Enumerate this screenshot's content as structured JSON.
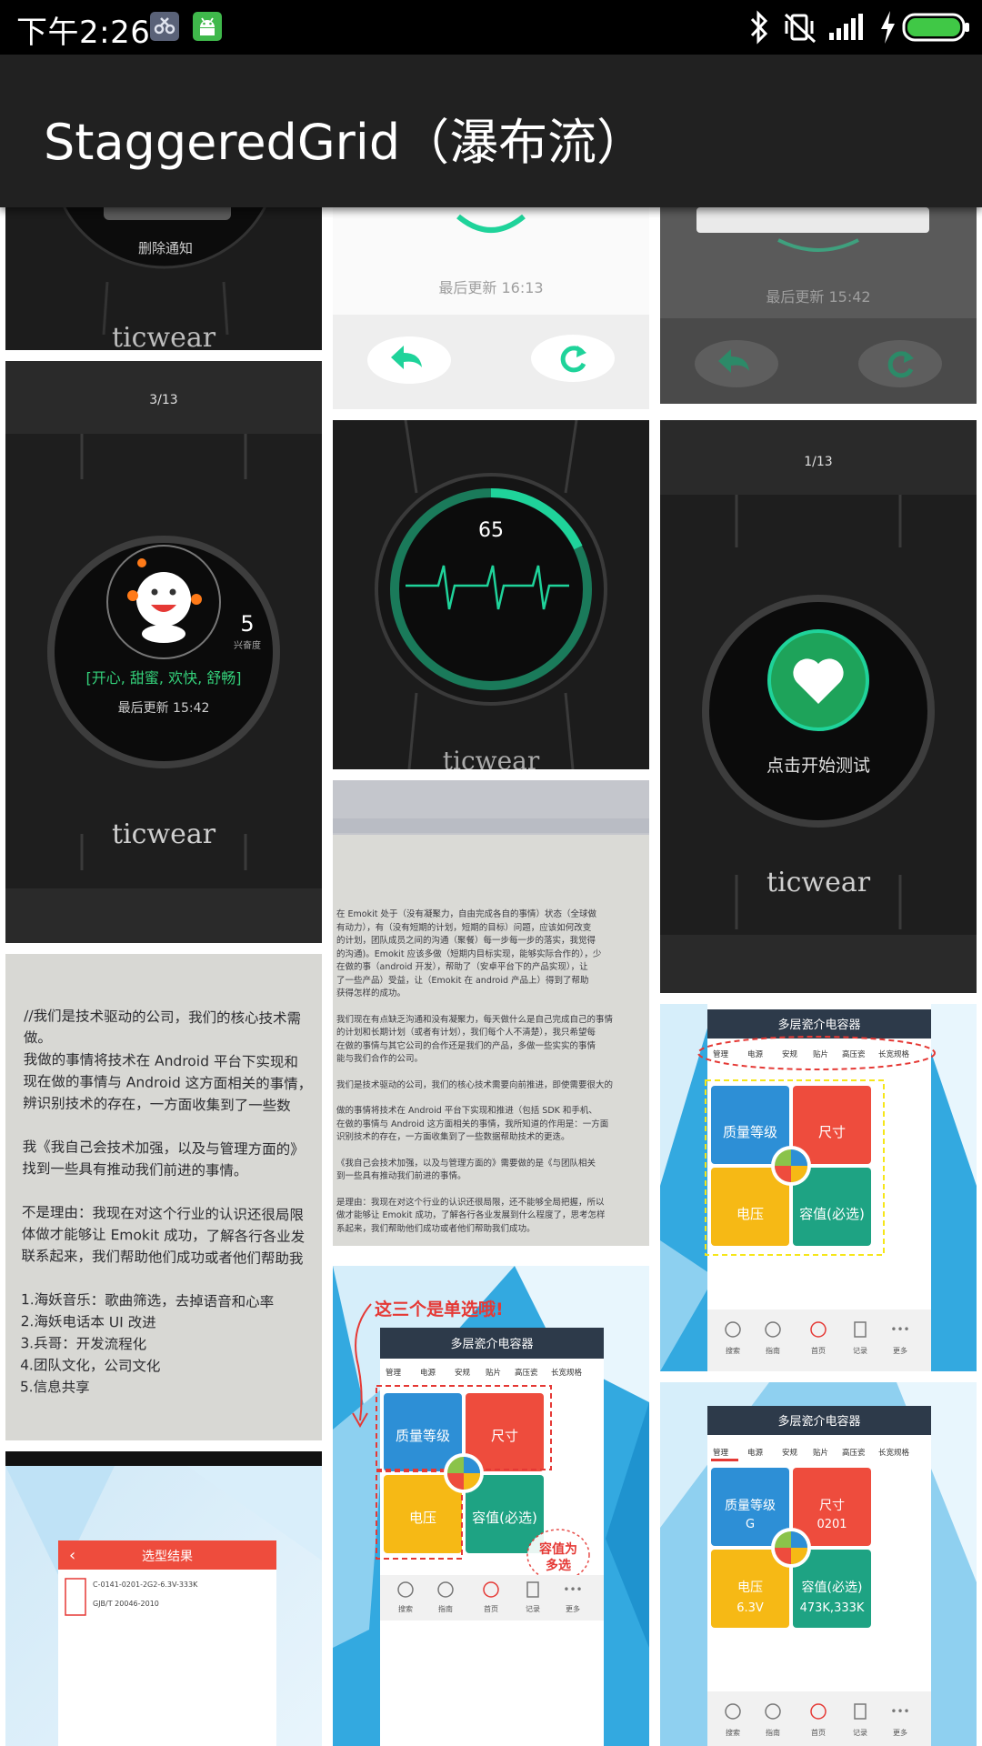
{
  "status_bar": {
    "time": "下午2:26",
    "icons": [
      "debug-app-icon",
      "android-icon",
      "bluetooth-icon",
      "vibrate-off-icon",
      "signal-icon",
      "charging-icon",
      "battery-icon"
    ]
  },
  "app_bar": {
    "title": "StaggeredGrid（瀑布流）"
  },
  "tiles": {
    "t1": {
      "brand": "ticwear",
      "menu": "删除通知"
    },
    "t2": {
      "updated": "最后更新 16:13"
    },
    "t3": {
      "updated": "最后更新 15:42"
    },
    "t4": {
      "count": "5",
      "count_label": "兴奋度",
      "moods": "[开心, 甜蜜, 欢快, 舒畅]",
      "updated": "最后更新 15:42",
      "brand": "ticwear",
      "header": "3/13"
    },
    "t5": {
      "heart_rate": "65",
      "brand": "ticwear"
    },
    "t6": {
      "prompt": "点击开始测试",
      "brand": "ticwear",
      "header": "1/13"
    },
    "t7": {
      "lines": [
        "//我们是技术驱动的公司，我们的核心技术需",
        "做。",
        "我做的事情将技术在 Android 平台下实现和",
        "现在做的事情与 Android 这方面相关的事情，",
        "辨识别技术的存在，一方面收集到了一些数",
        "",
        "我《我自己会技术加强，以及与管理方面的》",
        "找到一些具有推动我们前进的事情。",
        "",
        "不是理由：我现在对这个行业的认识还很局限",
        "体做才能够让 Emokit 成功，了解各行各业发",
        "联系起来，我们帮助他们成功或者他们帮助我",
        "",
        "1.海妖音乐：歌曲筛选，去掉语音和心率",
        "2.海妖电话本 UI 改进",
        "3.兵哥：开发流程化",
        "4.团队文化，公司文化",
        "5.信息共享"
      ]
    },
    "t8": {
      "lines": [
        "在 Emokit 处于（没有凝聚力，自由完成各自的事情）状态（全球做",
        "有动力），有（没有短期的计划，短期的目标）问题，应该如何改变",
        "的计划，团队成员之间的沟通（聚餐）每一步每一步的落实，我觉得",
        "的沟通)。Emokit 应该多做（短期内目标实现，能够实际合作的），少",
        "在做的事（android 开发），帮助了（安卓平台下的产品实现），让",
        "了一些产品）受益，让（Emokit 在 android 产品上）得到了帮助",
        "获得怎样的成功。",
        "",
        "我们现在有点缺乏沟通和没有凝聚力，每天做什么是自己完成自己的事情",
        "的计划和长期计划（或者有计划），我们每个人不清楚），我只希望每",
        "在做的事情与其它公司的合作还是我们的产品，多做一些实实的事情",
        "能与我们合作的公司。",
        "",
        "我们是技术驱动的公司，我们的核心技术需要向前推进，即使需要很大的",
        "",
        "做的事情将技术在 Android 平台下实现和推进（包括 SDK 和手机、",
        "在做的事情与 Android 这方面相关的事情，我所知道的作用是：一方面",
        "识别技术的存在，一方面收集到了一些数据帮助技术的更迭。",
        "",
        "《我自己会技术加强，以及与管理方面的》需要做的是《与团队相关",
        "到一些具有推动我们前进的事情。",
        "",
        "是理由：我现在对这个行业的认识还很局限，还不能够全局把握，所以",
        "做才能够让 Emokit 成功，了解各行各业发展到什么程度了，思考怎样",
        "系起来，我们帮助他们成功或者他们帮助我们成功。"
      ]
    },
    "t9": {
      "header": "多层瓷介电容器",
      "tabs": [
        "管理",
        "电源",
        "安规",
        "贴片",
        "高压瓷",
        "长宽规格"
      ],
      "cells": [
        "质量等级",
        "尺寸",
        "电压",
        "容值(必选)"
      ],
      "nav": [
        "搜索",
        "指南",
        "首页",
        "记录",
        "更多"
      ]
    },
    "t10": {
      "annotation_top": "这三个是单选哦!",
      "header": "多层瓷介电容器",
      "tabs": [
        "管理",
        "电源",
        "安规",
        "贴片",
        "高压瓷",
        "长宽规格"
      ],
      "cells": [
        "质量等级",
        "尺寸",
        "电压",
        "容值(必选)"
      ],
      "annotation_bottom": "容值为\n多选",
      "nav": [
        "搜索",
        "指南",
        "首页",
        "记录",
        "更多"
      ]
    },
    "t11": {
      "header": "多层瓷介电容器",
      "tabs": [
        "管理",
        "电源",
        "安规",
        "贴片",
        "高压瓷",
        "长宽规格"
      ],
      "cells": [
        "质量等级",
        "尺寸",
        "电压",
        "容值(必选)"
      ],
      "values": [
        "G",
        "0201",
        "6.3V",
        "473K,333K"
      ],
      "nav": [
        "搜索",
        "指南",
        "首页",
        "记录",
        "更多"
      ]
    },
    "t12": {
      "header": "选型结果",
      "row1": "C-0141-0201-2G2-6.3V-333K",
      "row2": "GJB/T 20046-2010"
    }
  },
  "colors": {
    "status_bar": "#000000",
    "app_bar": "#212121",
    "accent_green": "#1fd39a",
    "cell_blue": "#2d8fd6",
    "cell_red": "#ee4c3d",
    "cell_yellow": "#f6b915",
    "cell_teal": "#1ea383",
    "annotation_red": "#e53935"
  }
}
